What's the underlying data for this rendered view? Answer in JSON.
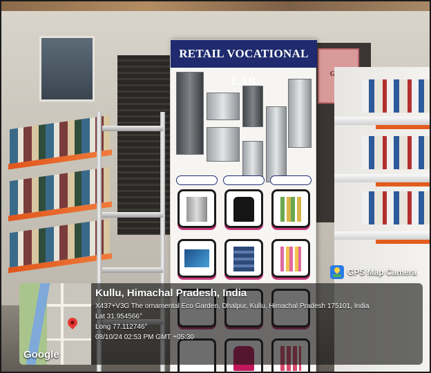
{
  "banner": {
    "title": "RETAIL VOCATIONAL LAB"
  },
  "wall_sign": {
    "text": "GIFT"
  },
  "overlay": {
    "app_badge": "GPS Map Camera",
    "map_brand": "Google",
    "location_title": "Kullu, Himachal Pradesh, India",
    "address": "X437+V3G The ornamental Eco Garden, Dhalpur, Kullu, Himachal Pradesh 175101, India",
    "latitude": "Lat 31.954566°",
    "longitude": "Long 77.112746°",
    "timestamp": "08/10/24 02:53 PM GMT +05:30"
  },
  "colors": {
    "banner_header": "#1f2b6e",
    "tile_accent": "#c5387a",
    "shelf_orange": "#e0561c"
  }
}
